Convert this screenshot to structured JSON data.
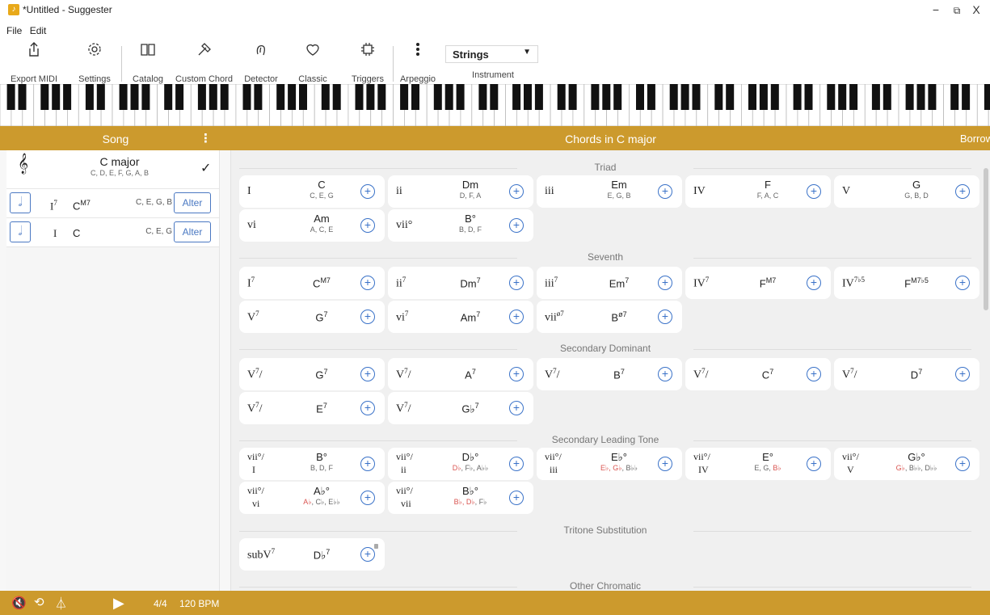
{
  "window": {
    "title": "*Untitled - Suggester",
    "minimize": "−",
    "restore": "⧉",
    "close": "X"
  },
  "menu": {
    "file": "File",
    "edit": "Edit"
  },
  "toolbar": {
    "export_midi": "Export MIDI",
    "settings": "Settings",
    "catalog": "Catalog",
    "custom_chord": "Custom Chord",
    "detector": "Detector",
    "classic": "Classic",
    "triggers": "Triggers",
    "arpeggio": "Arpeggio",
    "instrument_label": "Instrument",
    "instrument_value": "Strings"
  },
  "song": {
    "header": "Song",
    "key": {
      "name": "C major",
      "notes": "C, D, E, F, G, A, B"
    },
    "rows": [
      {
        "rn": "I",
        "rn_sup": "7",
        "chord": "C",
        "chord_sup": "M7",
        "notes": "C, E, G, B",
        "alter": "Alter"
      },
      {
        "rn": "I",
        "rn_sup": "",
        "chord": "C",
        "chord_sup": "",
        "notes": "C, E, G",
        "alter": "Alter"
      }
    ]
  },
  "transport": {
    "meter": "4/4",
    "tempo": "120 BPM"
  },
  "main": {
    "header": "Chords in C major",
    "borrow": "Borrow",
    "sections": {
      "triad": "Triad",
      "seventh": "Seventh",
      "secondary_dominant": "Secondary Dominant",
      "secondary_leading_tone": "Secondary Leading Tone",
      "tritone_substitution": "Tritone Substitution",
      "other_chromatic": "Other Chromatic"
    },
    "triads": [
      {
        "rn": "I",
        "chord": "C",
        "notes": "C, E, G"
      },
      {
        "rn": "ii",
        "chord": "Dm",
        "notes": "D, F, A"
      },
      {
        "rn": "iii",
        "chord": "Em",
        "notes": "E, G, B"
      },
      {
        "rn": "IV",
        "chord": "F",
        "notes": "F, A, C"
      },
      {
        "rn": "V",
        "chord": "G",
        "notes": "G, B, D"
      },
      {
        "rn": "vi",
        "chord": "Am",
        "notes": "A, C, E"
      },
      {
        "rn": "vii°",
        "chord": "B°",
        "notes": "B, D, F"
      }
    ],
    "sevenths": [
      {
        "rn": "I",
        "rn_sup": "7",
        "chord": "C",
        "chord_sup": "M7"
      },
      {
        "rn": "ii",
        "rn_sup": "7",
        "chord": "Dm",
        "chord_sup": "7"
      },
      {
        "rn": "iii",
        "rn_sup": "7",
        "chord": "Em",
        "chord_sup": "7"
      },
      {
        "rn": "IV",
        "rn_sup": "7",
        "chord": "F",
        "chord_sup": "M7"
      },
      {
        "rn": "IV",
        "rn_sup": "7♭5",
        "chord": "F",
        "chord_sup": "M7♭5"
      },
      {
        "rn": "V",
        "rn_sup": "7",
        "chord": "G",
        "chord_sup": "7"
      },
      {
        "rn": "vi",
        "rn_sup": "7",
        "chord": "Am",
        "chord_sup": "7"
      },
      {
        "rn": "vii",
        "rn_sup": "ø7",
        "chord": "B",
        "chord_sup": "ø7"
      }
    ],
    "secondary_dominants": [
      {
        "rn": "V",
        "rn_sup": "7",
        "slash": "/",
        "chord": "G",
        "chord_sup": "7"
      },
      {
        "rn": "V",
        "rn_sup": "7",
        "slash": "/",
        "chord": "A",
        "chord_sup": "7"
      },
      {
        "rn": "V",
        "rn_sup": "7",
        "slash": "/",
        "chord": "B",
        "chord_sup": "7"
      },
      {
        "rn": "V",
        "rn_sup": "7",
        "slash": "/",
        "chord": "C",
        "chord_sup": "7"
      },
      {
        "rn": "V",
        "rn_sup": "7",
        "slash": "/",
        "chord": "D",
        "chord_sup": "7"
      },
      {
        "rn": "V",
        "rn_sup": "7",
        "slash": "/",
        "chord": "E",
        "chord_sup": "7"
      },
      {
        "rn": "V",
        "rn_sup": "7",
        "slash": "/",
        "chord": "G♭",
        "chord_sup": "7"
      }
    ],
    "secondary_leading_tones": [
      {
        "rn_top": "vii°/",
        "rn_bottom": "I",
        "chord": "B°",
        "notes": [
          {
            "t": "B, D, F",
            "red": false
          }
        ]
      },
      {
        "rn_top": "vii°/",
        "rn_bottom": "ii",
        "chord": "D♭°",
        "notes": [
          {
            "t": "D♭",
            "red": true
          },
          {
            "t": ", F♭, A♭♭",
            "red": false
          }
        ]
      },
      {
        "rn_top": "vii°/",
        "rn_bottom": "iii",
        "chord": "E♭°",
        "notes": [
          {
            "t": "E♭, G♭",
            "red": true
          },
          {
            "t": ", B♭♭",
            "red": false
          }
        ]
      },
      {
        "rn_top": "vii°/",
        "rn_bottom": "IV",
        "chord": "E°",
        "notes": [
          {
            "t": "E, G, ",
            "red": false
          },
          {
            "t": "B♭",
            "red": true
          }
        ]
      },
      {
        "rn_top": "vii°/",
        "rn_bottom": "V",
        "chord": "G♭°",
        "notes": [
          {
            "t": "G♭",
            "red": true
          },
          {
            "t": ", B♭♭, D♭♭",
            "red": false
          }
        ]
      },
      {
        "rn_top": "vii°/",
        "rn_bottom": "vi",
        "chord": "A♭°",
        "notes": [
          {
            "t": "A♭",
            "red": true
          },
          {
            "t": ", C♭, E♭♭",
            "red": false
          }
        ]
      },
      {
        "rn_top": "vii°/",
        "rn_bottom": "vii",
        "chord": "B♭°",
        "notes": [
          {
            "t": "B♭, D♭",
            "red": true
          },
          {
            "t": ", F♭",
            "red": false
          }
        ]
      }
    ],
    "tritone": [
      {
        "rn": "subV",
        "rn_sup": "7",
        "chord": "D♭",
        "chord_sup": "7"
      }
    ]
  },
  "colors": {
    "accent": "#cc9a2d",
    "link": "#3a72c8",
    "warning_note": "#d9534f"
  }
}
